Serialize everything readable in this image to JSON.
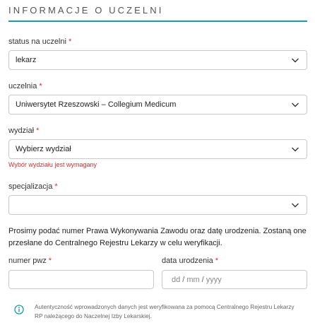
{
  "section": {
    "title": "INFORMACJE O UCZELNI"
  },
  "fields": {
    "status": {
      "label": "status na uczelni",
      "required_mark": "*",
      "value": "lekarz"
    },
    "university": {
      "label": "uczelnia",
      "required_mark": "*",
      "value": "Uniwersytet Rzeszowski – Collegium Medicum"
    },
    "faculty": {
      "label": "wydział",
      "required_mark": "*",
      "value": "Wybierz wydział",
      "error": "Wybór wydziału jest wymagany"
    },
    "specialization": {
      "label": "specjalizacja",
      "required_mark": "*",
      "value": ""
    },
    "pwz": {
      "label": "numer pwz",
      "required_mark": "*",
      "value": ""
    },
    "birthdate": {
      "label": "data urodzenia",
      "required_mark": "*",
      "dd": "dd",
      "mm": "mm",
      "yyyy": "yyyy",
      "sep": "/"
    }
  },
  "instructions": "Prosimy podać numer Prawa Wykonywania Zawodu oraz datę urodzenia. Zostaną one przesłane do Centralnego Rejestru Lekarzy w celu weryfikacji.",
  "note": {
    "icon": "info-icon",
    "text": "Autentyczność wprowadzonych danych jest weryfikowana za pomocą Centralnego Rejestru Lekarzy RP należącego do Naczelnej Izby Lekarskiej."
  },
  "colors": {
    "accent": "#1b9ca8",
    "required": "#d32f2f",
    "error": "#d32f2f",
    "info_icon": "#1b9ca8"
  }
}
